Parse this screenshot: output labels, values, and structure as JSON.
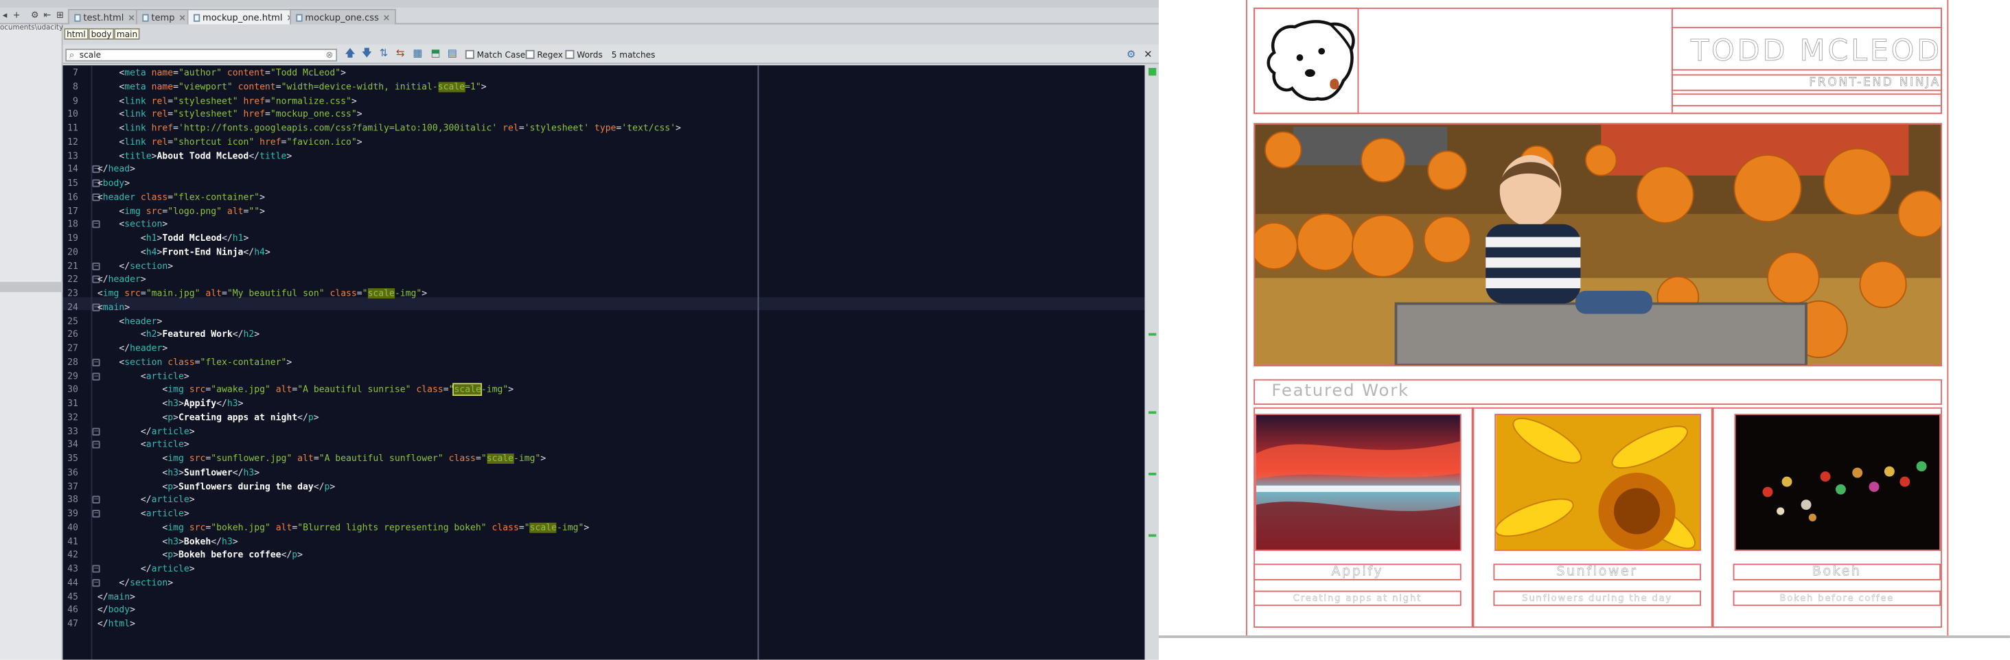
{
  "ide": {
    "tabs": [
      {
        "label": "test.html"
      },
      {
        "label": "temp"
      },
      {
        "label": "mockup_one.html"
      },
      {
        "label": "mockup_one.css"
      }
    ],
    "path_text": "ocuments\\udacity",
    "breadcrumb": [
      "html",
      "body",
      "main"
    ],
    "find": {
      "query": "scale",
      "match_case": "Match Case",
      "regex": "Regex",
      "words": "Words",
      "matches": "5 matches"
    },
    "lines": [
      {
        "n": "7",
        "html": "    <span class='tg'>&lt;</span><span class='nm'>meta</span> <span class='at'>name</span>=<span class='st'>\"author\"</span> <span class='at'>content</span>=<span class='st'>\"Todd McLeod\"</span><span class='tg'>&gt;</span>"
      },
      {
        "n": "8",
        "html": "    <span class='tg'>&lt;</span><span class='nm'>meta</span> <span class='at'>name</span>=<span class='st'>\"viewport\"</span> <span class='at'>content</span>=<span class='st'>\"width=device-width, initial-<span class='hl'>scale</span>=1\"</span><span class='tg'>&gt;</span>"
      },
      {
        "n": "9",
        "html": "    <span class='tg'>&lt;</span><span class='nm'>link</span> <span class='at'>rel</span>=<span class='st'>\"stylesheet\"</span> <span class='at'>href</span>=<span class='st'>\"normalize.css\"</span><span class='tg'>&gt;</span>"
      },
      {
        "n": "10",
        "html": "    <span class='tg'>&lt;</span><span class='nm'>link</span> <span class='at'>rel</span>=<span class='st'>\"stylesheet\"</span> <span class='at'>href</span>=<span class='st'>\"mockup_one.css\"</span><span class='tg'>&gt;</span>"
      },
      {
        "n": "11",
        "html": "    <span class='tg'>&lt;</span><span class='nm'>link</span> <span class='at'>href</span>=<span class='st'>'http://fonts.googleapis.com/css?family=Lato:100,300italic'</span> <span class='at'>rel</span>=<span class='st'>'stylesheet'</span> <span class='at'>type</span>=<span class='st'>'text/css'</span><span class='tg'>&gt;</span>"
      },
      {
        "n": "12",
        "html": "    <span class='tg'>&lt;</span><span class='nm'>link</span> <span class='at'>rel</span>=<span class='st'>\"shortcut icon\"</span> <span class='at'>href</span>=<span class='st'>\"favicon.ico\"</span><span class='tg'>&gt;</span>"
      },
      {
        "n": "13",
        "html": "    <span class='tg'>&lt;</span><span class='nm'>title</span><span class='tg'>&gt;</span><span class='tx'>About Todd McLeod</span><span class='tg'>&lt;/</span><span class='nm'>title</span><span class='tg'>&gt;</span>"
      },
      {
        "n": "14",
        "html": "<span class='tg'>&lt;/</span><span class='nm'>head</span><span class='tg'>&gt;</span>"
      },
      {
        "n": "15",
        "html": "<span class='tg'>&lt;</span><span class='nm'>body</span><span class='tg'>&gt;</span>"
      },
      {
        "n": "16",
        "html": "<span class='tg'>&lt;</span><span class='nm'>header</span> <span class='at'>class</span>=<span class='st'>\"flex-container\"</span><span class='tg'>&gt;</span>"
      },
      {
        "n": "17",
        "html": "    <span class='tg'>&lt;</span><span class='nm'>img</span> <span class='at'>src</span>=<span class='st'>\"logo.png\"</span> <span class='at'>alt</span>=<span class='st'>\"\"</span><span class='tg'>&gt;</span>"
      },
      {
        "n": "18",
        "html": "    <span class='tg'>&lt;</span><span class='nm'>section</span><span class='tg'>&gt;</span>"
      },
      {
        "n": "19",
        "html": "        <span class='tg'>&lt;</span><span class='nm'>h1</span><span class='tg'>&gt;</span><span class='tx'>Todd McLeod</span><span class='tg'>&lt;/</span><span class='nm'>h1</span><span class='tg'>&gt;</span>"
      },
      {
        "n": "20",
        "html": "        <span class='tg'>&lt;</span><span class='nm'>h4</span><span class='tg'>&gt;</span><span class='tx'>Front-End Ninja</span><span class='tg'>&lt;/</span><span class='nm'>h4</span><span class='tg'>&gt;</span>"
      },
      {
        "n": "21",
        "html": "    <span class='tg'>&lt;/</span><span class='nm'>section</span><span class='tg'>&gt;</span>"
      },
      {
        "n": "22",
        "html": "<span class='tg'>&lt;/</span><span class='nm'>header</span><span class='tg'>&gt;</span>"
      },
      {
        "n": "23",
        "html": "<span class='tg'>&lt;</span><span class='nm'>img</span> <span class='at'>src</span>=<span class='st'>\"main.jpg\"</span> <span class='at'>alt</span>=<span class='st'>\"My beautiful son\"</span> <span class='at'>class</span>=<span class='st'>\"<span class='hl'>scale</span>-img\"</span><span class='tg'>&gt;</span>"
      },
      {
        "n": "24",
        "html": "<span class='tg'>&lt;</span><span class='nm'>main</span><span class='tg'>&gt;</span>"
      },
      {
        "n": "25",
        "html": "    <span class='tg'>&lt;</span><span class='nm'>header</span><span class='tg'>&gt;</span>"
      },
      {
        "n": "26",
        "html": "        <span class='tg'>&lt;</span><span class='nm'>h2</span><span class='tg'>&gt;</span><span class='tx'>Featured Work</span><span class='tg'>&lt;/</span><span class='nm'>h2</span><span class='tg'>&gt;</span>"
      },
      {
        "n": "27",
        "html": "    <span class='tg'>&lt;/</span><span class='nm'>header</span><span class='tg'>&gt;</span>"
      },
      {
        "n": "28",
        "html": "    <span class='tg'>&lt;</span><span class='nm'>section</span> <span class='at'>class</span>=<span class='st'>\"flex-container\"</span><span class='tg'>&gt;</span>"
      },
      {
        "n": "29",
        "html": "        <span class='tg'>&lt;</span><span class='nm'>article</span><span class='tg'>&gt;</span>"
      },
      {
        "n": "30",
        "html": "            <span class='tg'>&lt;</span><span class='nm'>img</span> <span class='at'>src</span>=<span class='st'>\"awake.jpg\"</span> <span class='at'>alt</span>=<span class='st'>\"A beautiful sunrise\"</span> <span class='at'>class</span>=<span class='st'>\"<span class='hls'>scale</span>-img\"</span><span class='tg'>&gt;</span>"
      },
      {
        "n": "31",
        "html": "            <span class='tg'>&lt;</span><span class='nm'>h3</span><span class='tg'>&gt;</span><span class='tx'>Appify</span><span class='tg'>&lt;/</span><span class='nm'>h3</span><span class='tg'>&gt;</span>"
      },
      {
        "n": "32",
        "html": "            <span class='tg'>&lt;</span><span class='nm'>p</span><span class='tg'>&gt;</span><span class='tx'>Creating apps at night</span><span class='tg'>&lt;/</span><span class='nm'>p</span><span class='tg'>&gt;</span>"
      },
      {
        "n": "33",
        "html": "        <span class='tg'>&lt;/</span><span class='nm'>article</span><span class='tg'>&gt;</span>"
      },
      {
        "n": "34",
        "html": "        <span class='tg'>&lt;</span><span class='nm'>article</span><span class='tg'>&gt;</span>"
      },
      {
        "n": "35",
        "html": "            <span class='tg'>&lt;</span><span class='nm'>img</span> <span class='at'>src</span>=<span class='st'>\"sunflower.jpg\"</span> <span class='at'>alt</span>=<span class='st'>\"A beautiful sunflower\"</span> <span class='at'>class</span>=<span class='st'>\"<span class='hl'>scale</span>-img\"</span><span class='tg'>&gt;</span>"
      },
      {
        "n": "36",
        "html": "            <span class='tg'>&lt;</span><span class='nm'>h3</span><span class='tg'>&gt;</span><span class='tx'>Sunflower</span><span class='tg'>&lt;/</span><span class='nm'>h3</span><span class='tg'>&gt;</span>"
      },
      {
        "n": "37",
        "html": "            <span class='tg'>&lt;</span><span class='nm'>p</span><span class='tg'>&gt;</span><span class='tx'>Sunflowers during the day</span><span class='tg'>&lt;/</span><span class='nm'>p</span><span class='tg'>&gt;</span>"
      },
      {
        "n": "38",
        "html": "        <span class='tg'>&lt;/</span><span class='nm'>article</span><span class='tg'>&gt;</span>"
      },
      {
        "n": "39",
        "html": "        <span class='tg'>&lt;</span><span class='nm'>article</span><span class='tg'>&gt;</span>"
      },
      {
        "n": "40",
        "html": "            <span class='tg'>&lt;</span><span class='nm'>img</span> <span class='at'>src</span>=<span class='st'>\"bokeh.jpg\"</span> <span class='at'>alt</span>=<span class='st'>\"Blurred lights representing bokeh\"</span> <span class='at'>class</span>=<span class='st'>\"<span class='hl'>scale</span>-img\"</span><span class='tg'>&gt;</span>"
      },
      {
        "n": "41",
        "html": "            <span class='tg'>&lt;</span><span class='nm'>h3</span><span class='tg'>&gt;</span><span class='tx'>Bokeh</span><span class='tg'>&lt;/</span><span class='nm'>h3</span><span class='tg'>&gt;</span>"
      },
      {
        "n": "42",
        "html": "            <span class='tg'>&lt;</span><span class='nm'>p</span><span class='tg'>&gt;</span><span class='tx'>Bokeh before coffee</span><span class='tg'>&lt;/</span><span class='nm'>p</span><span class='tg'>&gt;</span>"
      },
      {
        "n": "43",
        "html": "        <span class='tg'>&lt;/</span><span class='nm'>article</span><span class='tg'>&gt;</span>"
      },
      {
        "n": "44",
        "html": "    <span class='tg'>&lt;/</span><span class='nm'>section</span><span class='tg'>&gt;</span>"
      },
      {
        "n": "45",
        "html": "<span class='tg'>&lt;/</span><span class='nm'>main</span><span class='tg'>&gt;</span>"
      },
      {
        "n": "46",
        "html": "<span class='tg'>&lt;/</span><span class='nm'>body</span><span class='tg'>&gt;</span>"
      },
      {
        "n": "47",
        "html": "<span class='tg'>&lt;/</span><span class='nm'>html</span><span class='tg'>&gt;</span>"
      }
    ]
  },
  "preview": {
    "name": "TODD MCLEOD",
    "subtitle": "FRONT-END NINJA",
    "featured": "Featured Work",
    "cards": [
      {
        "title": "Appify",
        "desc": "Creating apps at night"
      },
      {
        "title": "Sunflower",
        "desc": "Sunflowers during the day"
      },
      {
        "title": "Bokeh",
        "desc": "Bokeh before coffee"
      }
    ]
  },
  "colors": {
    "editor_bg": "#0f1223",
    "outline": "#e06a6a",
    "highlight": "#5c6a12"
  }
}
